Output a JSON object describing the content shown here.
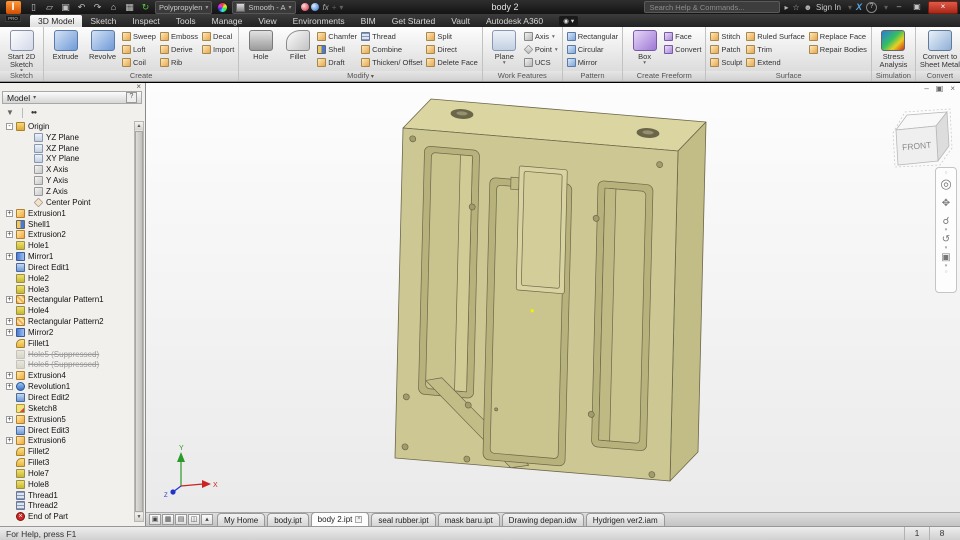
{
  "titlebar": {
    "logo_text": "PRO",
    "title": "body 2",
    "material_dropdown": "Polypropylen",
    "appearance_dropdown": "Smooth - A",
    "search_placeholder": "Search Help & Commands...",
    "sign_in_label": "Sign In",
    "qat_icons": [
      {
        "name": "new-file-icon",
        "glyph": "▯"
      },
      {
        "name": "open-icon",
        "glyph": "▱"
      },
      {
        "name": "save-icon",
        "glyph": "▣"
      },
      {
        "name": "undo-icon",
        "glyph": "↶"
      },
      {
        "name": "redo-icon",
        "glyph": "↷"
      },
      {
        "name": "home-icon",
        "glyph": "⌂"
      },
      {
        "name": "render-gallery-icon",
        "glyph": "▦"
      },
      {
        "name": "update-icon",
        "glyph": "↻",
        "green": true
      }
    ]
  },
  "ui": {
    "dropdown": "▾",
    "minimize": "–",
    "restore": "▣",
    "close": "×",
    "help": "?",
    "star": "☆",
    "person": "☻",
    "send": "▸",
    "app_exchange": "X",
    "screencast": "◉",
    "panel_close": "×",
    "funnel": "▼",
    "find": "●●",
    "scroll_up": "▲",
    "scroll_down": "▼",
    "fx": "fx",
    "plus": "+",
    "ribbon_expand": "▾"
  },
  "ribbon_tabs": [
    {
      "label": "3D Model",
      "active": true
    },
    {
      "label": "Sketch"
    },
    {
      "label": "Inspect"
    },
    {
      "label": "Tools"
    },
    {
      "label": "Manage"
    },
    {
      "label": "View"
    },
    {
      "label": "Environments"
    },
    {
      "label": "BIM"
    },
    {
      "label": "Get Started"
    },
    {
      "label": "Vault"
    },
    {
      "label": "Autodesk A360"
    }
  ],
  "ribbon": {
    "groups": [
      {
        "label": "Sketch",
        "big": [
          {
            "label": "Start 2D Sketch",
            "icon": "start-2d-sketch",
            "dd": true
          }
        ],
        "small": []
      },
      {
        "label": "Create",
        "big": [
          {
            "label": "Extrude",
            "icon": "extrude"
          },
          {
            "label": "Revolve",
            "icon": "revolve"
          }
        ],
        "small": [
          {
            "label": "Sweep",
            "icon": "sweep"
          },
          {
            "label": "Loft",
            "icon": "loft"
          },
          {
            "label": "Coil",
            "icon": "coil"
          },
          {
            "label": "Emboss",
            "icon": "emboss"
          },
          {
            "label": "Derive",
            "icon": "derive"
          },
          {
            "label": "Rib",
            "icon": "rib"
          },
          {
            "label": "Decal",
            "icon": "decal"
          },
          {
            "label": "Import",
            "icon": "import"
          }
        ]
      },
      {
        "label": "Modify",
        "menu": true,
        "big": [
          {
            "label": "Hole",
            "icon": "hole"
          },
          {
            "label": "Fillet",
            "icon": "fillet"
          }
        ],
        "small": [
          {
            "label": "Chamfer",
            "icon": "chamfer"
          },
          {
            "label": "Shell",
            "icon": "shell"
          },
          {
            "label": "Draft",
            "icon": "draft"
          },
          {
            "label": "Thread",
            "icon": "thread"
          },
          {
            "label": "Combine",
            "icon": "combine"
          },
          {
            "label": "Thicken/ Offset",
            "icon": "thicken-offset"
          },
          {
            "label": "Split",
            "icon": "split"
          },
          {
            "label": "Direct",
            "icon": "direct"
          },
          {
            "label": "Delete Face",
            "icon": "delete-face"
          }
        ]
      },
      {
        "label": "Work Features",
        "big": [
          {
            "label": "Plane",
            "icon": "plane",
            "dd": true
          }
        ],
        "small": [
          {
            "label": "Axis",
            "icon": "axis",
            "dd": true
          },
          {
            "label": "Point",
            "icon": "point",
            "dd": true
          },
          {
            "label": "UCS",
            "icon": "ucs"
          }
        ]
      },
      {
        "label": "Pattern",
        "big": [],
        "small": [
          {
            "label": "Rectangular",
            "icon": "rectangular-pattern"
          },
          {
            "label": "Circular",
            "icon": "circular-pattern"
          },
          {
            "label": "Mirror",
            "icon": "mirror-pattern"
          }
        ]
      },
      {
        "label": "Create Freeform",
        "big": [
          {
            "label": "Box",
            "icon": "box",
            "dd": true
          }
        ],
        "small": [
          {
            "label": "Face",
            "icon": "face"
          },
          {
            "label": "Convert",
            "icon": "convert-freeform"
          }
        ]
      },
      {
        "label": "Surface",
        "big": [],
        "small": [
          {
            "label": "Stitch",
            "icon": "stitch"
          },
          {
            "label": "Patch",
            "icon": "patch"
          },
          {
            "label": "Sculpt",
            "icon": "sculpt"
          },
          {
            "label": "Ruled Surface",
            "icon": "ruled-surface"
          },
          {
            "label": "Trim",
            "icon": "trim"
          },
          {
            "label": "Extend",
            "icon": "extend"
          },
          {
            "label": "Replace Face",
            "icon": "replace-face"
          },
          {
            "label": "Repair Bodies",
            "icon": "repair-bodies"
          }
        ]
      },
      {
        "label": "Simulation",
        "big": [
          {
            "label": "Stress Analysis",
            "icon": "stress-analysis"
          }
        ],
        "small": []
      },
      {
        "label": "Convert",
        "big": [
          {
            "label": "Convert to Sheet Metal",
            "icon": "sheet-metal"
          }
        ],
        "small": []
      }
    ]
  },
  "browser": {
    "panel_title": "Model",
    "tree": [
      {
        "label": "Origin",
        "icon": "folder",
        "expand": "-"
      },
      {
        "label": "YZ Plane",
        "icon": "plane",
        "child": true
      },
      {
        "label": "XZ Plane",
        "icon": "plane",
        "child": true
      },
      {
        "label": "XY Plane",
        "icon": "plane",
        "child": true
      },
      {
        "label": "X Axis",
        "icon": "axis",
        "child": true
      },
      {
        "label": "Y Axis",
        "icon": "axis",
        "child": true
      },
      {
        "label": "Z Axis",
        "icon": "axis",
        "child": true
      },
      {
        "label": "Center Point",
        "icon": "point",
        "child": true
      },
      {
        "label": "Extrusion1",
        "icon": "extrusion",
        "expand": "+"
      },
      {
        "label": "Shell1",
        "icon": "shell"
      },
      {
        "label": "Extrusion2",
        "icon": "extrusion",
        "expand": "+"
      },
      {
        "label": "Hole1",
        "icon": "hole-f"
      },
      {
        "label": "Mirror1",
        "icon": "mirror",
        "expand": "+"
      },
      {
        "label": "Direct Edit1",
        "icon": "direct-edit"
      },
      {
        "label": "Hole2",
        "icon": "hole-f"
      },
      {
        "label": "Hole3",
        "icon": "hole-f"
      },
      {
        "label": "Rectangular Pattern1",
        "icon": "pattern",
        "expand": "+"
      },
      {
        "label": "Hole4",
        "icon": "hole-f"
      },
      {
        "label": "Rectangular Pattern2",
        "icon": "pattern",
        "expand": "+"
      },
      {
        "label": "Mirror2",
        "icon": "mirror",
        "expand": "+"
      },
      {
        "label": "Fillet1",
        "icon": "fillet-f"
      },
      {
        "label": "Hole5 (Suppressed)",
        "icon": "hole-f",
        "suppressed": true
      },
      {
        "label": "Hole6 (Suppressed)",
        "icon": "hole-f",
        "suppressed": true
      },
      {
        "label": "Extrusion4",
        "icon": "extrusion",
        "expand": "+"
      },
      {
        "label": "Revolution1",
        "icon": "revolution",
        "expand": "+"
      },
      {
        "label": "Direct Edit2",
        "icon": "direct-edit"
      },
      {
        "label": "Sketch8",
        "icon": "sketch"
      },
      {
        "label": "Extrusion5",
        "icon": "extrusion",
        "expand": "+"
      },
      {
        "label": "Direct Edit3",
        "icon": "direct-edit"
      },
      {
        "label": "Extrusion6",
        "icon": "extrusion",
        "expand": "+"
      },
      {
        "label": "Fillet2",
        "icon": "fillet-f"
      },
      {
        "label": "Fillet3",
        "icon": "fillet-f"
      },
      {
        "label": "Hole7",
        "icon": "hole-f"
      },
      {
        "label": "Hole8",
        "icon": "hole-f"
      },
      {
        "label": "Thread1",
        "icon": "thread"
      },
      {
        "label": "Thread2",
        "icon": "thread"
      },
      {
        "label": "End of Part",
        "icon": "end"
      }
    ]
  },
  "viewport": {
    "viewcube_front": "FRONT",
    "triad": {
      "x": "X",
      "y": "Y",
      "z": "Z"
    },
    "nav_icons": [
      {
        "name": "navigation-wheel-icon",
        "glyph": "◎",
        "big": true
      },
      {
        "name": "pan-icon",
        "glyph": "✥"
      },
      {
        "name": "zoom-icon",
        "glyph": "☌",
        "dd": true
      },
      {
        "name": "orbit-icon",
        "glyph": "↺",
        "dd": true
      },
      {
        "name": "look-at-icon",
        "glyph": "▣",
        "dd": true
      }
    ],
    "model_colors": {
      "top": "#dad5a1",
      "front": "#cdc893",
      "side": "#c2bc87",
      "pocket": "#b7b17c",
      "floor": "#c9c38e",
      "edge": "#6b6649"
    }
  },
  "window_arrange": [
    {
      "name": "cascade-windows-button",
      "glyph": "▣"
    },
    {
      "name": "tile-grid-button",
      "glyph": "▦"
    },
    {
      "name": "tile-horizontal-button",
      "glyph": "▤"
    },
    {
      "name": "tile-vertical-button",
      "glyph": "◫"
    },
    {
      "name": "expand-tabs-button",
      "glyph": "▴"
    }
  ],
  "doc_tabs": [
    {
      "label": "My Home"
    },
    {
      "label": "body.ipt"
    },
    {
      "label": "body 2.ipt",
      "active": true
    },
    {
      "label": "seal rubber.ipt"
    },
    {
      "label": "mask baru.ipt"
    },
    {
      "label": "Drawing depan.idw"
    },
    {
      "label": "Hydrigen ver2.iam"
    }
  ],
  "statusbar": {
    "message": "For Help, press F1",
    "fields": [
      "1",
      "8"
    ]
  }
}
